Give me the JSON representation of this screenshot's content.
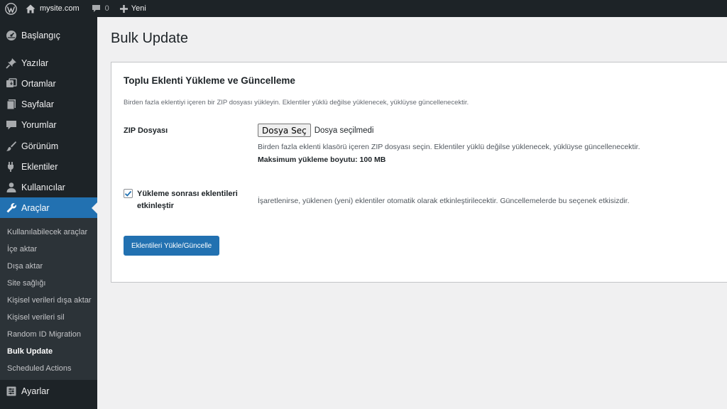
{
  "adminbar": {
    "site_name": "mysite.com",
    "comments_count": "0",
    "new_label": "Yeni"
  },
  "sidebar": {
    "items": [
      {
        "label": "Başlangıç",
        "icon": "dashboard-icon"
      },
      {
        "label": "Yazılar",
        "icon": "pin-icon"
      },
      {
        "label": "Ortamlar",
        "icon": "media-icon"
      },
      {
        "label": "Sayfalar",
        "icon": "page-icon"
      },
      {
        "label": "Yorumlar",
        "icon": "comment-icon"
      },
      {
        "label": "Görünüm",
        "icon": "brush-icon"
      },
      {
        "label": "Eklentiler",
        "icon": "plugin-icon"
      },
      {
        "label": "Kullanıcılar",
        "icon": "user-icon"
      },
      {
        "label": "Araçlar",
        "icon": "wrench-icon"
      },
      {
        "label": "Ayarlar",
        "icon": "settings-icon"
      }
    ],
    "submenu": [
      "Kullanılabilecek araçlar",
      "İçe aktar",
      "Dışa aktar",
      "Site sağlığı",
      "Kişisel verileri dışa aktar",
      "Kişisel verileri sil",
      "Random ID Migration",
      "Bulk Update",
      "Scheduled Actions"
    ],
    "current_submenu": "Bulk Update"
  },
  "page": {
    "title": "Bulk Update"
  },
  "card": {
    "title": "Toplu Eklenti Yükleme ve Güncelleme",
    "description": "Birden fazla eklentiyi içeren bir ZIP dosyası yükleyin. Eklentiler yüklü değilse yüklenecek, yüklüyse güncellenecektir.",
    "zip_label": "ZIP Dosyası",
    "file_button": "Dosya Seç",
    "file_status": "Dosya seçilmedi",
    "zip_help": "Birden fazla eklenti klasörü içeren ZIP dosyası seçin. Eklentiler yüklü değilse yüklenecek, yüklüyse güncellenecektir.",
    "max_size": "Maksimum yükleme boyutu: 100 MB",
    "activate_label": "Yükleme sonrası eklentileri etkinleştir",
    "activate_checked": true,
    "activate_help": "İşaretlenirse, yüklenen (yeni) eklentiler otomatik olarak etkinleştirilecektir. Güncellemelerde bu seçenek etkisizdir.",
    "submit_label": "Eklentileri Yükle/Güncelle"
  },
  "colors": {
    "adminbar_bg": "#1d2327",
    "sidebar_bg": "#1d2327",
    "submenu_bg": "#2c3338",
    "accent": "#2271b1",
    "page_bg": "#f0f0f1"
  }
}
